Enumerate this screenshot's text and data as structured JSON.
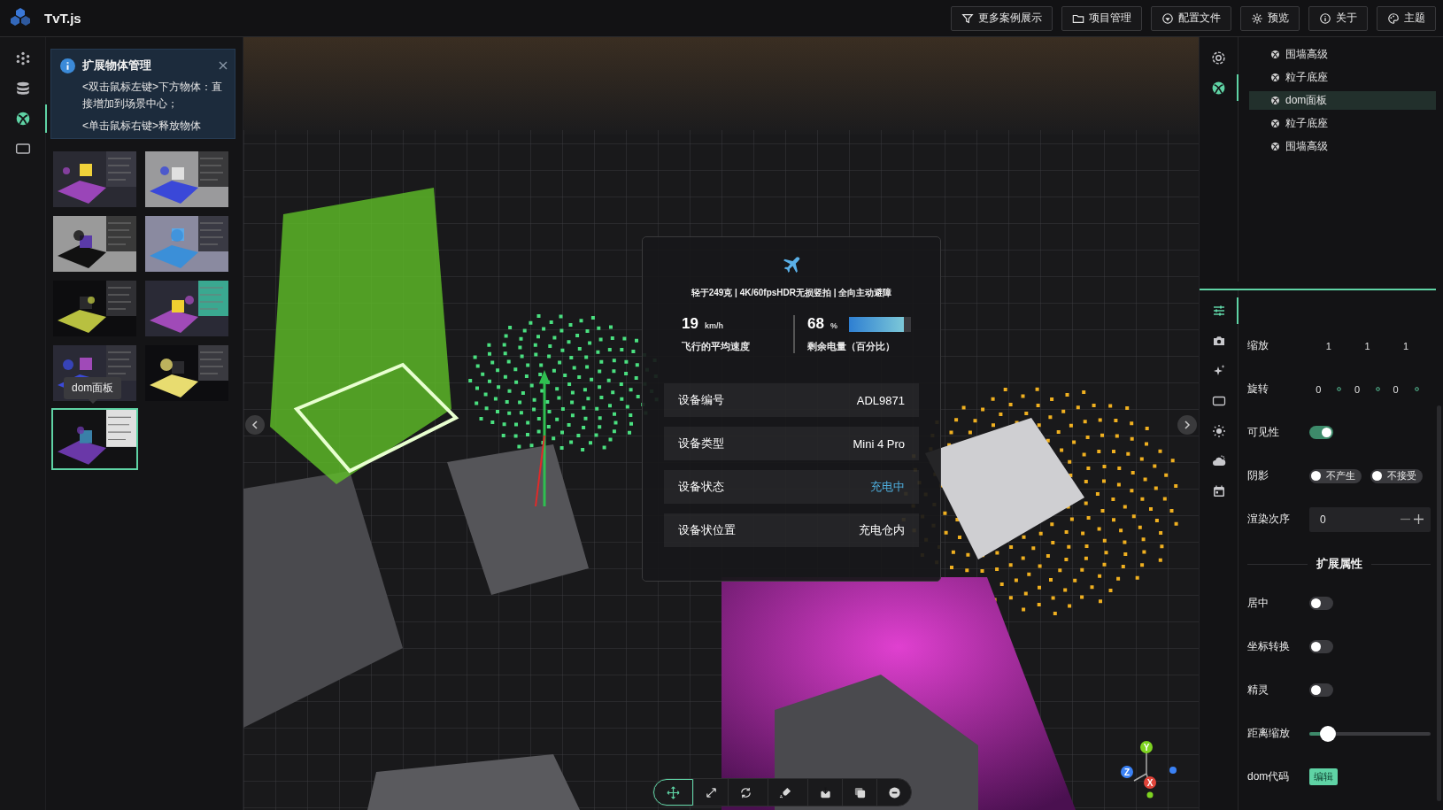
{
  "app": {
    "title": "TvT.js"
  },
  "top_buttons": [
    {
      "label": "更多案例展示"
    },
    {
      "label": "项目管理"
    },
    {
      "label": "配置文件"
    },
    {
      "label": "预览"
    },
    {
      "label": "关于"
    },
    {
      "label": "主题"
    }
  ],
  "left_strip": [
    {
      "selected": false
    },
    {
      "selected": false
    },
    {
      "selected": true
    },
    {
      "selected": false
    }
  ],
  "notice": {
    "title": "扩展物体管理",
    "lines": [
      "<双击鼠标左键>下方物体：直接增加到场景中心；",
      "<单击鼠标右键>释放物体"
    ]
  },
  "thumbnails": [
    {
      "selected": false
    },
    {
      "selected": false
    },
    {
      "selected": false
    },
    {
      "selected": false
    },
    {
      "selected": false
    },
    {
      "selected": false
    },
    {
      "selected": false
    },
    {
      "selected": false
    },
    {
      "selected": true
    }
  ],
  "tooltip": "dom面板",
  "popup": {
    "tagline": "轻于249克 | 4K/60fpsHDR无损竖拍 | 全向主动避障",
    "stats": [
      {
        "value": "19",
        "unit": "km/h",
        "label": "飞行的平均速度"
      },
      {
        "value": "68",
        "unit": "%",
        "label": "剩余电量（百分比）",
        "level": 0.88
      }
    ],
    "rows": [
      {
        "label": "设备编号",
        "value": "ADL9871",
        "color": "#ffffff"
      },
      {
        "label": "设备类型",
        "value": "Mini 4 Pro",
        "color": "#ffffff"
      },
      {
        "label": "设备状态",
        "value": "充电中",
        "color": "#4fb0e0"
      },
      {
        "label": "设备状位置",
        "value": "充电仓内",
        "color": "#ffffff"
      }
    ]
  },
  "toolbar": [
    {
      "selected": true
    },
    {
      "selected": false
    },
    {
      "selected": false
    },
    {
      "selected": false
    },
    {
      "selected": false
    },
    {
      "selected": false
    },
    {
      "selected": false
    }
  ],
  "gizmo": {
    "labels": [
      "Y",
      "Z",
      "X"
    ]
  },
  "right_strip": [
    {
      "selected": false
    },
    {
      "selected": true
    }
  ],
  "tree": [
    {
      "label": "围墙高级",
      "selected": false
    },
    {
      "label": "粒子底座",
      "selected": false
    },
    {
      "label": "dom面板",
      "selected": true
    },
    {
      "label": "粒子底座",
      "selected": false
    },
    {
      "label": "围墙高级",
      "selected": false
    }
  ],
  "prop_strip": [
    {
      "selected": true
    },
    {
      "selected": false
    },
    {
      "selected": false
    },
    {
      "selected": false
    },
    {
      "selected": false
    },
    {
      "selected": false
    },
    {
      "selected": false
    }
  ],
  "properties": [
    {
      "kind": "triple",
      "label": "缩放",
      "values": [
        "1",
        "1",
        "1"
      ]
    },
    {
      "kind": "angles",
      "label": "旋转",
      "values": [
        "0",
        "0",
        "0"
      ]
    },
    {
      "kind": "switch",
      "label": "可见性",
      "on": true
    },
    {
      "kind": "chips",
      "label": "阴影",
      "chips": [
        {
          "label": "不产生",
          "on": false
        },
        {
          "label": "不接受",
          "on": false
        }
      ]
    },
    {
      "kind": "number",
      "label": "渲染次序",
      "value": "0"
    },
    {
      "kind": "heading",
      "label": "扩展属性"
    },
    {
      "kind": "switch",
      "label": "居中",
      "on": false
    },
    {
      "kind": "switch",
      "label": "坐标转换",
      "on": false
    },
    {
      "kind": "switch",
      "label": "精灵",
      "on": false
    },
    {
      "kind": "slider",
      "label": "距离缩放",
      "level": 0.15
    },
    {
      "kind": "button",
      "label": "dom代码",
      "button": "编辑"
    }
  ]
}
